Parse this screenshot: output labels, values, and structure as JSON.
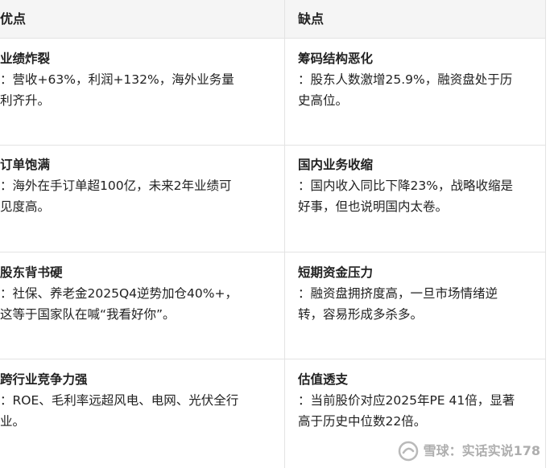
{
  "table": {
    "headers": {
      "pros": "优点",
      "cons": "缺点"
    },
    "rows": [
      {
        "pro_title": "业绩炸裂",
        "pro_line1": "：营收+63%，利润+132%，海外业务量",
        "pro_line2": "利齐升。",
        "con_title": "筹码结构恶化",
        "con_line1": "：股东人数激增25.9%，融资盘处于历",
        "con_line2": "史高位。"
      },
      {
        "pro_title": "订单饱满",
        "pro_line1": "：海外在手订单超100亿，未来2年业绩可",
        "pro_line2": "见度高。",
        "con_title": "国内业务收缩",
        "con_line1": "：国内收入同比下降23%，战略收缩是",
        "con_line2": "好事，但也说明国内太卷。"
      },
      {
        "pro_title": "股东背书硬",
        "pro_line1": "：社保、养老金2025Q4逆势加仓40%+，",
        "pro_line2": "这等于国家队在喊“我看好你”。",
        "con_title": "短期资金压力",
        "con_line1": "：融资盘拥挤度高，一旦市场情绪逆",
        "con_line2": "转，容易形成多杀多。"
      },
      {
        "pro_title": "跨行业竞争力强",
        "pro_line1": "：ROE、毛利率远超风电、电网、光伏全行",
        "pro_line2": "业。",
        "con_title": "估值透支",
        "con_line1": "：当前股价对应2025年PE 41倍，显著",
        "con_line2": "高于历史中位数22倍。"
      }
    ]
  },
  "watermark": {
    "text": "雪球：实话实说178",
    "icon": "snowball-logo-icon"
  }
}
